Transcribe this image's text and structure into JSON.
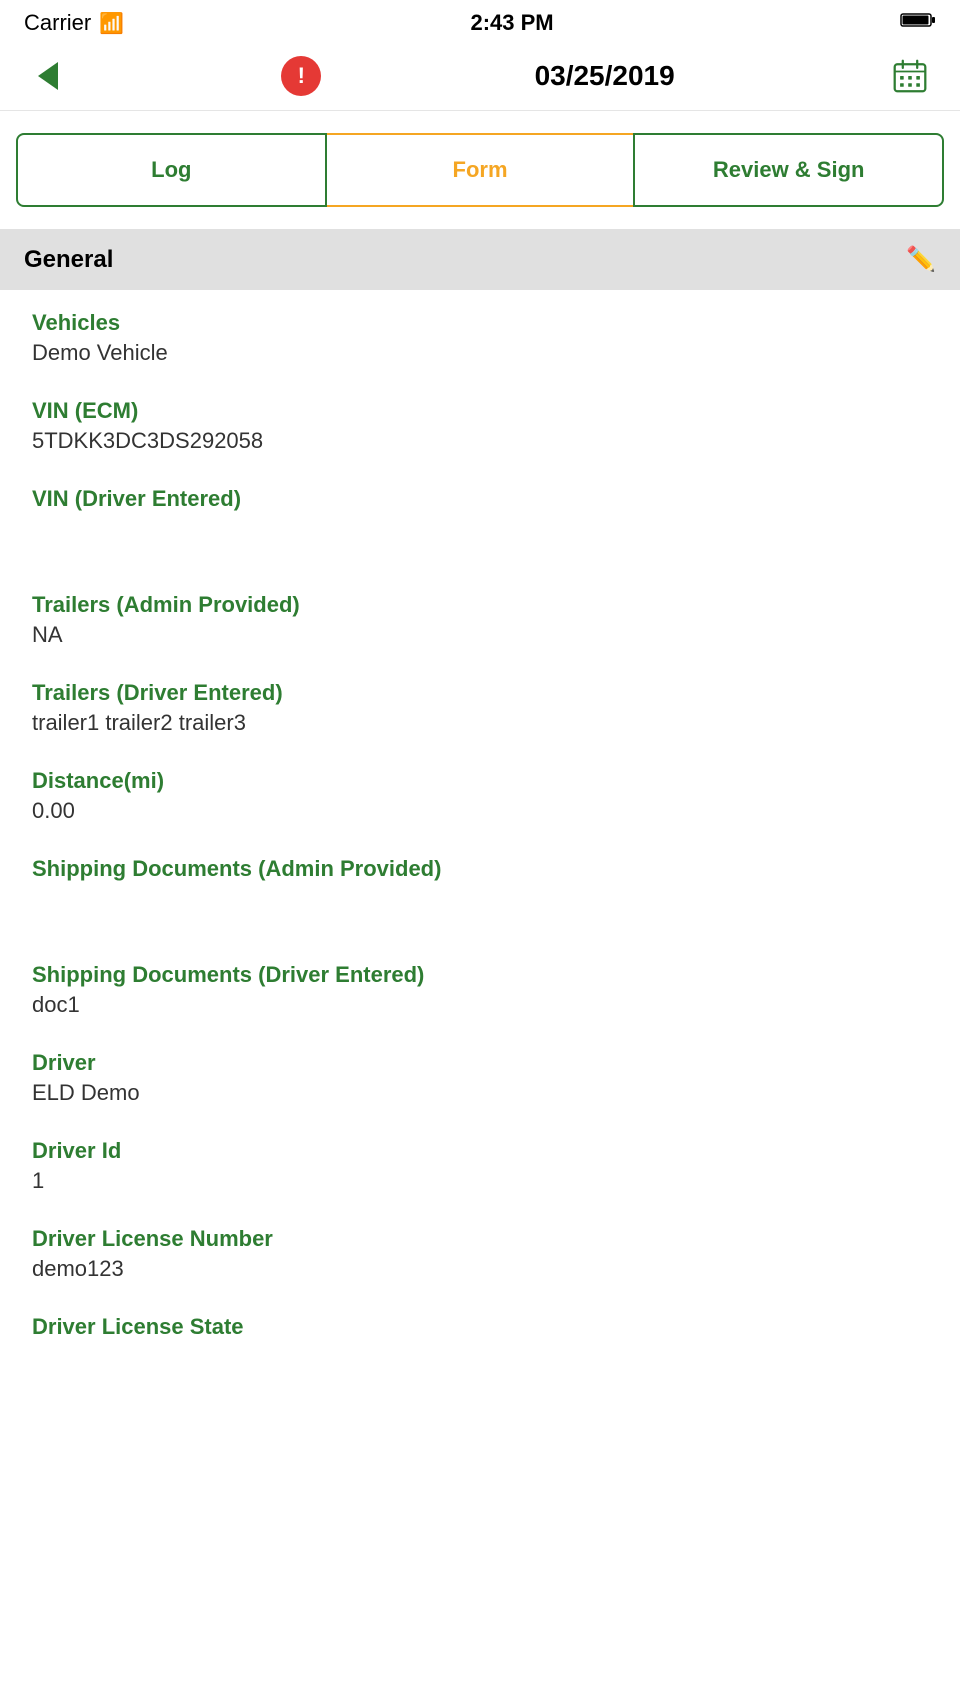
{
  "statusBar": {
    "carrier": "Carrier",
    "wifi": "📶",
    "time": "2:43 PM",
    "battery": "🔋"
  },
  "navBar": {
    "date": "03/25/2019",
    "alertIcon": "!",
    "calendarIcon": "calendar"
  },
  "tabs": {
    "log": "Log",
    "form": "Form",
    "reviewSign": "Review & Sign"
  },
  "sections": {
    "general": {
      "title": "General",
      "fields": [
        {
          "label": "Vehicles",
          "value": "Demo Vehicle"
        },
        {
          "label": "VIN (ECM)",
          "value": "5TDKK3DC3DS292058"
        },
        {
          "label": "VIN (Driver Entered)",
          "value": ""
        },
        {
          "label": "Trailers (Admin Provided)",
          "value": "NA"
        },
        {
          "label": "Trailers (Driver Entered)",
          "value": "trailer1 trailer2 trailer3"
        },
        {
          "label": "Distance(mi)",
          "value": "0.00"
        },
        {
          "label": "Shipping Documents (Admin Provided)",
          "value": ""
        },
        {
          "label": "Shipping Documents (Driver Entered)",
          "value": "doc1"
        },
        {
          "label": "Driver",
          "value": "ELD Demo"
        },
        {
          "label": "Driver Id",
          "value": "1"
        },
        {
          "label": "Driver License Number",
          "value": "demo123"
        },
        {
          "label": "Driver License State",
          "value": ""
        }
      ]
    }
  }
}
